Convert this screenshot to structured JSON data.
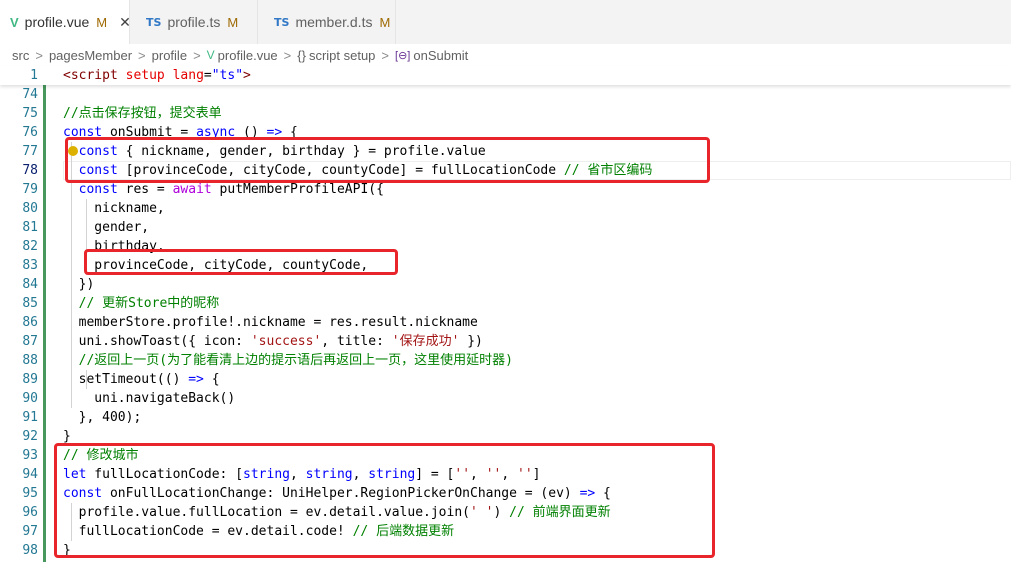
{
  "tabs": [
    {
      "name": "profile.vue",
      "modified": "M",
      "active": true,
      "icon": "vue-icon"
    },
    {
      "name": "profile.ts",
      "modified": "M",
      "active": false,
      "icon": "ts-icon"
    },
    {
      "name": "member.d.ts",
      "modified": "M",
      "active": false,
      "icon": "ts-icon"
    }
  ],
  "tab_icons": {
    "vue": "V",
    "ts": "TS",
    "close": "✕"
  },
  "breadcrumb": {
    "items": [
      "src",
      "pagesMember",
      "profile",
      "profile.vue",
      "script setup",
      "onSubmit"
    ],
    "separator": ">",
    "brace_glyph": "{}",
    "event_glyph": "[⊖]"
  },
  "lines": [
    {
      "no": "1",
      "text": "<script setup lang=\"ts\">"
    },
    {
      "no": "74",
      "text": ""
    },
    {
      "no": "75",
      "text": "//点击保存按钮，提交表单"
    },
    {
      "no": "76",
      "text": "const onSubmit = async () => {"
    },
    {
      "no": "77",
      "text": "  const { nickname, gender, birthday } = profile.value"
    },
    {
      "no": "78",
      "text": "  const [provinceCode, cityCode, countyCode] = fullLocationCode // 省市区编码"
    },
    {
      "no": "79",
      "text": "  const res = await putMemberProfileAPI({"
    },
    {
      "no": "80",
      "text": "    nickname,"
    },
    {
      "no": "81",
      "text": "    gender,"
    },
    {
      "no": "82",
      "text": "    birthday,"
    },
    {
      "no": "83",
      "text": "    provinceCode, cityCode, countyCode,"
    },
    {
      "no": "84",
      "text": "  })"
    },
    {
      "no": "85",
      "text": "  // 更新Store中的昵称"
    },
    {
      "no": "86",
      "text": "  memberStore.profile!.nickname = res.result.nickname"
    },
    {
      "no": "87",
      "text": "  uni.showToast({ icon: 'success', title: '保存成功' })"
    },
    {
      "no": "88",
      "text": "  //返回上一页(为了能看清上边的提示语后再返回上一页，这里使用延时器)"
    },
    {
      "no": "89",
      "text": "  setTimeout(() => {"
    },
    {
      "no": "90",
      "text": "    uni.navigateBack()"
    },
    {
      "no": "91",
      "text": "  }, 400);"
    },
    {
      "no": "92",
      "text": "}"
    },
    {
      "no": "93",
      "text": "// 修改城市"
    },
    {
      "no": "94",
      "text": "let fullLocationCode: [string, string, string] = ['', '', '']"
    },
    {
      "no": "95",
      "text": "const onFullLocationChange: UniHelper.RegionPickerOnChange = (ev) => {"
    },
    {
      "no": "96",
      "text": "  profile.value.fullLocation = ev.detail.value.join(' ') // 前端界面更新"
    },
    {
      "no": "97",
      "text": "  fullLocationCode = ev.detail.code! // 后端数据更新"
    },
    {
      "no": "98",
      "text": "}"
    }
  ],
  "colors": {
    "keyword": "#0000ff",
    "control": "#af00db",
    "string": "#a31515",
    "comment": "#008000",
    "line_number": "#237893",
    "annotation_box": "#e8252a",
    "modified_badge": "#9e6a03"
  }
}
